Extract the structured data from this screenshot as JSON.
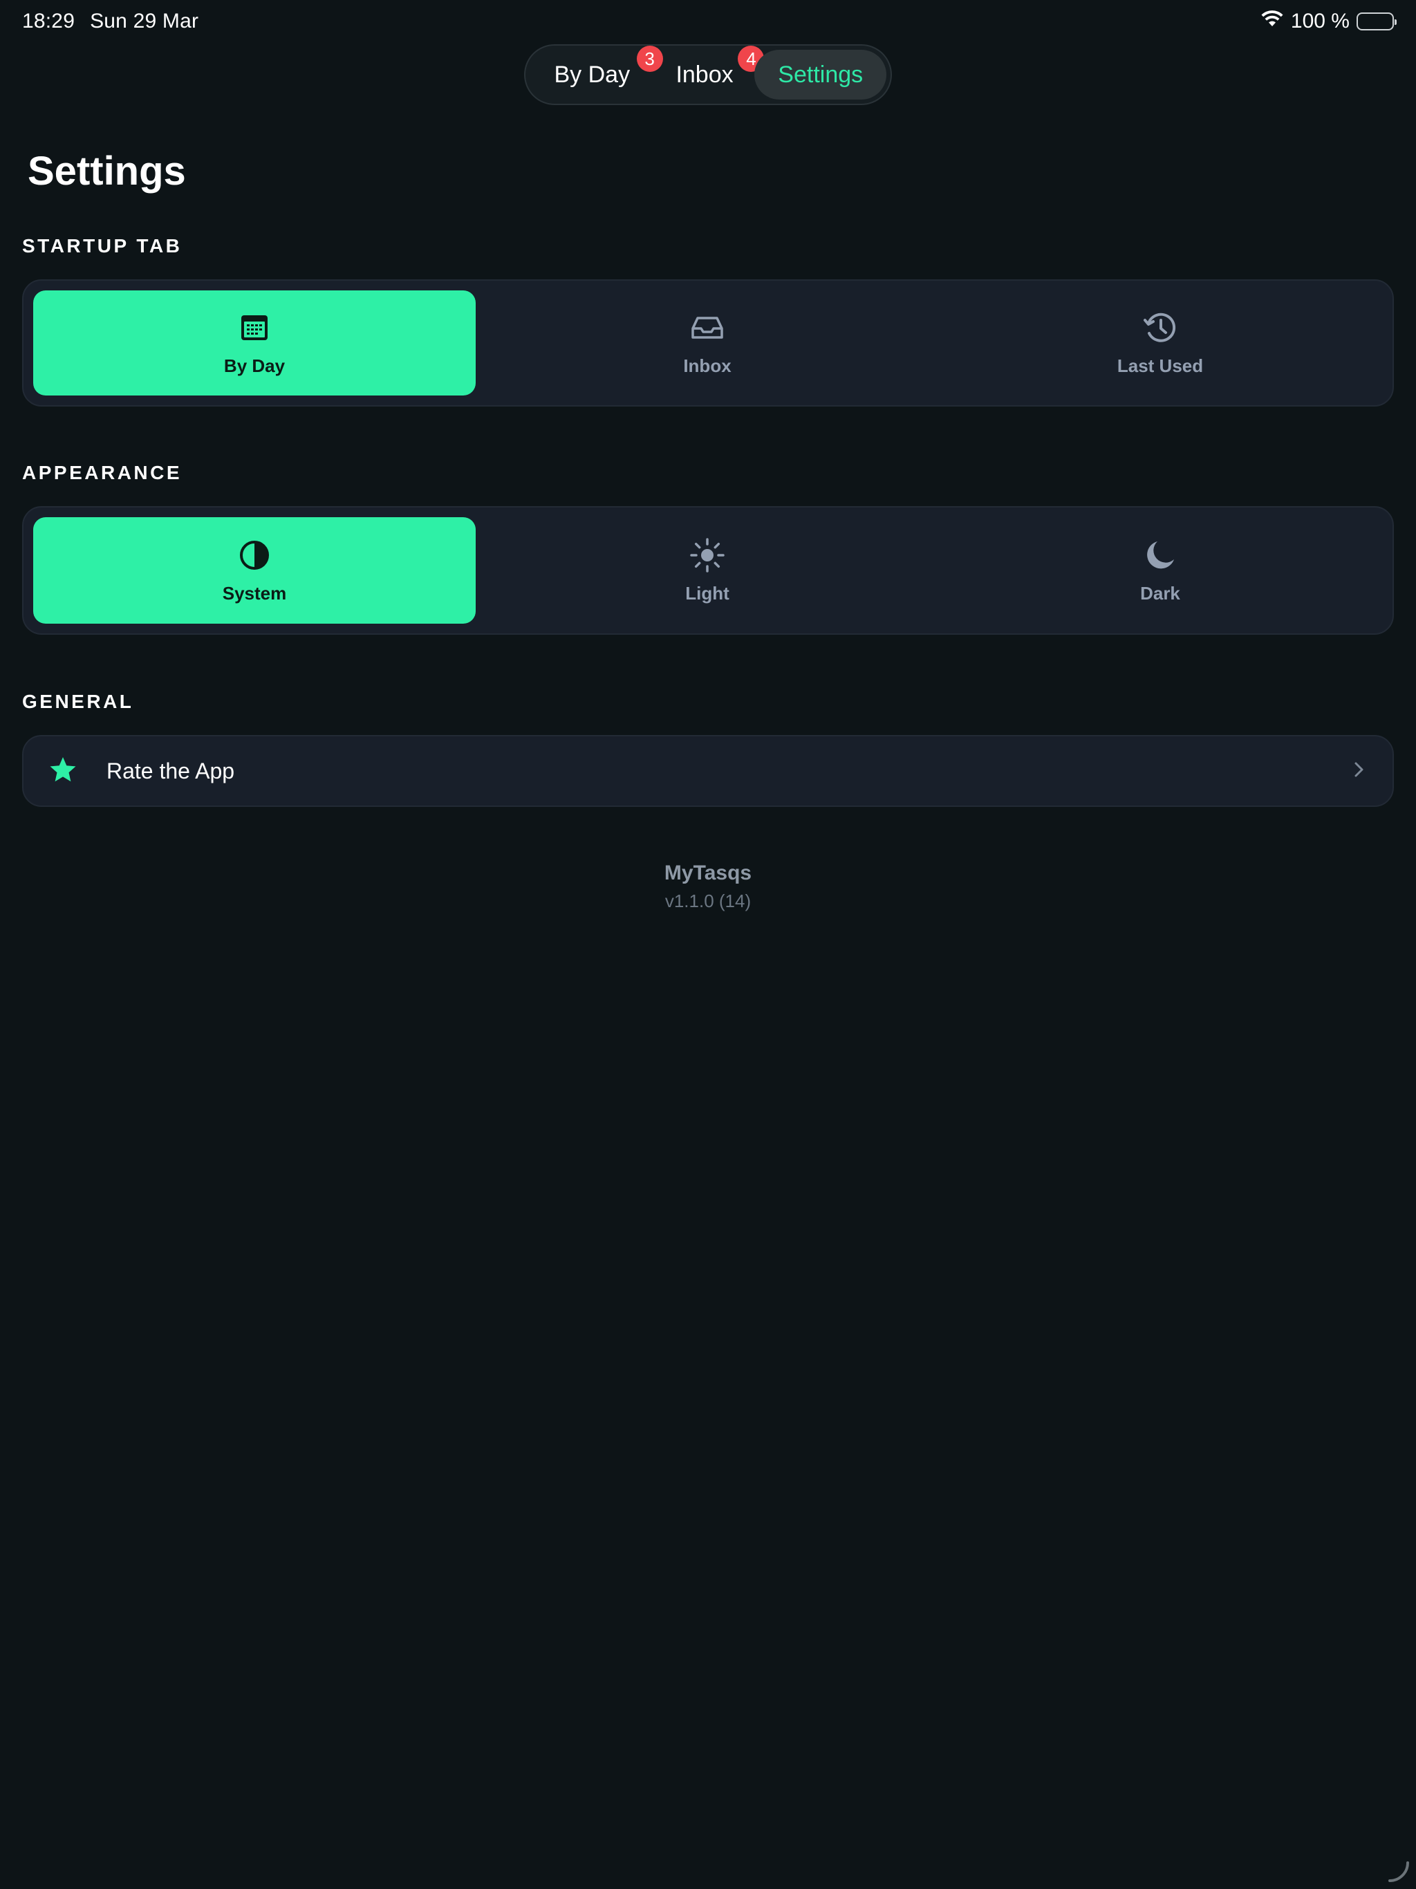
{
  "status_bar": {
    "time": "18:29",
    "date": "Sun 29 Mar",
    "battery_percent": "100 %"
  },
  "tabs": [
    {
      "label": "By Day",
      "badge": "3"
    },
    {
      "label": "Inbox",
      "badge": "4"
    },
    {
      "label": "Settings",
      "selected": true
    }
  ],
  "page_title": "Settings",
  "startup_tab": {
    "header": "STARTUP TAB",
    "options": [
      {
        "label": "By Day",
        "icon": "calendar-icon",
        "selected": true
      },
      {
        "label": "Inbox",
        "icon": "inbox-tray-icon",
        "selected": false
      },
      {
        "label": "Last Used",
        "icon": "history-icon",
        "selected": false
      }
    ]
  },
  "appearance": {
    "header": "APPEARANCE",
    "options": [
      {
        "label": "System",
        "icon": "contrast-icon",
        "selected": true
      },
      {
        "label": "Light",
        "icon": "sun-icon",
        "selected": false
      },
      {
        "label": "Dark",
        "icon": "moon-icon",
        "selected": false
      }
    ]
  },
  "general": {
    "header": "GENERAL",
    "items": [
      {
        "label": "Rate the App",
        "icon": "star-icon"
      }
    ]
  },
  "footer": {
    "app_name": "MyTasqs",
    "version": "v1.1.0 (14)"
  },
  "colors": {
    "background": "#0d1417",
    "accent": "#2ef0a6",
    "card": "#181f2a",
    "badge": "#f0454b",
    "muted_text": "#94a0b2"
  }
}
